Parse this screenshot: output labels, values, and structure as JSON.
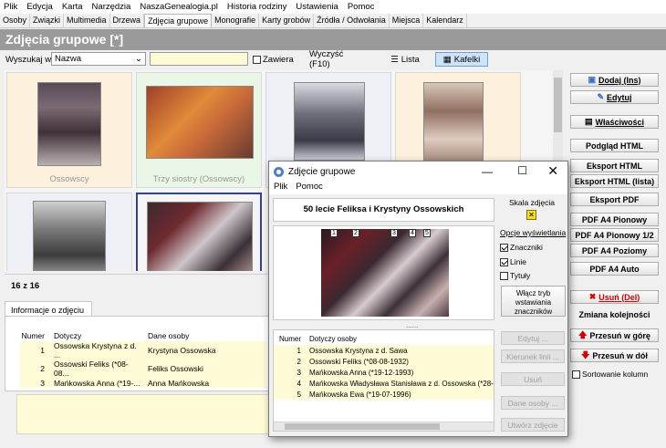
{
  "menu": [
    "Plik",
    "Edycja",
    "Karta",
    "Narzędzia",
    "NaszaGenealogia.pl",
    "Historia rodziny",
    "Ustawienia",
    "Pomoc"
  ],
  "tabs": [
    "Osoby",
    "Związki",
    "Multimedia",
    "Drzewa",
    "Zdjęcia grupowe",
    "Monografie",
    "Karty grobów",
    "Źródła / Odwołania",
    "Miejsca",
    "Kalendarz"
  ],
  "page_title": "Zdjęcia grupowe [*]",
  "search": {
    "label": "Wyszukaj w",
    "field_value": "Nazwa",
    "query": "",
    "contains_label": "Zawiera",
    "clear_label": "Wyczyść (F10)",
    "list_label": "Lista",
    "tiles_label": "Kafelki"
  },
  "tiles": [
    {
      "caption": "Ossowscy"
    },
    {
      "caption": "Trzy siostry (Ossowscy)"
    },
    {
      "caption": ""
    },
    {
      "caption": ""
    },
    {
      "caption": ""
    },
    {
      "caption": ""
    }
  ],
  "count": "16 z 16",
  "info_tab": "Informacje o zdjęciu",
  "info_table": {
    "headers": [
      "Numer",
      "Dotyczy",
      "Dane osoby"
    ],
    "rows": [
      [
        "1",
        "Ossowska Krystyna z d. ...",
        "Krystyna Ossowska"
      ],
      [
        "2",
        "Ossowski Feliks  (*08-08...",
        "Feliks Ossowski"
      ],
      [
        "3",
        "Mańkowska Anna  (*19-...",
        "Anna Mańkowska"
      ]
    ]
  },
  "right_buttons": {
    "add": "Dodaj  (Ins)",
    "edit": "Edytuj",
    "props": "Właściwości",
    "html_preview": "Podgląd HTML",
    "html_export": "Eksport HTML",
    "html_export_list": "Eksport HTML (lista)",
    "pdf_export": "Eksport PDF",
    "pdf_portrait": "PDF A4 Pionowy",
    "pdf_portrait_half": "PDF A4 Pionowy 1/2",
    "pdf_landscape": "PDF A4 Poziomy",
    "pdf_auto": "PDF A4 Auto",
    "delete": "Usuń  (Del)",
    "order_label": "Zmiana kolejności",
    "move_up": "Przesuń w górę",
    "move_down": "Przesuń w dół",
    "sort_columns": "Sortowanie kolumn"
  },
  "dialog": {
    "title": "Zdjęcie grupowe",
    "menu": [
      "Plik",
      "Pomoc"
    ],
    "photo_title": "50 lecie Feliksa i Krystyny Ossowskich",
    "scale_label": "Skala zdjęcia",
    "display_options": "Opcje wyświetlania",
    "markers_label": "Znaczniki",
    "lines_label": "Linie",
    "titles_label": "Tytuły",
    "insert_mode_btn": "Włącz tryb wstawiania znaczników",
    "markers": [
      "1",
      "2",
      "3",
      "4",
      "5"
    ],
    "table_headers": [
      "Numer",
      "Dotyczy osoby"
    ],
    "rows": [
      [
        "1",
        "Ossowska Krystyna z d. Sawa"
      ],
      [
        "2",
        "Ossowski Feliks  (*08-08-1932)"
      ],
      [
        "3",
        "Mańkowska Anna  (*19-12-1993)"
      ],
      [
        "4",
        "Mańkowska Władysława Stanisława z d. Ossowska  (*28-"
      ],
      [
        "5",
        "Mańkowska Ewa  (*19-07-1996)"
      ]
    ],
    "side_buttons": [
      "Edytuj ...",
      "Kierunek linii ...",
      "Usuń",
      "Dane osoby ...",
      "Utwórz zdjęcie"
    ]
  },
  "colors": {
    "title_bg": "#9a9a9a",
    "row_highlight": "#fffbd6",
    "tile_selected_border": "#2f3fb0",
    "delete_red": "#d40000"
  }
}
